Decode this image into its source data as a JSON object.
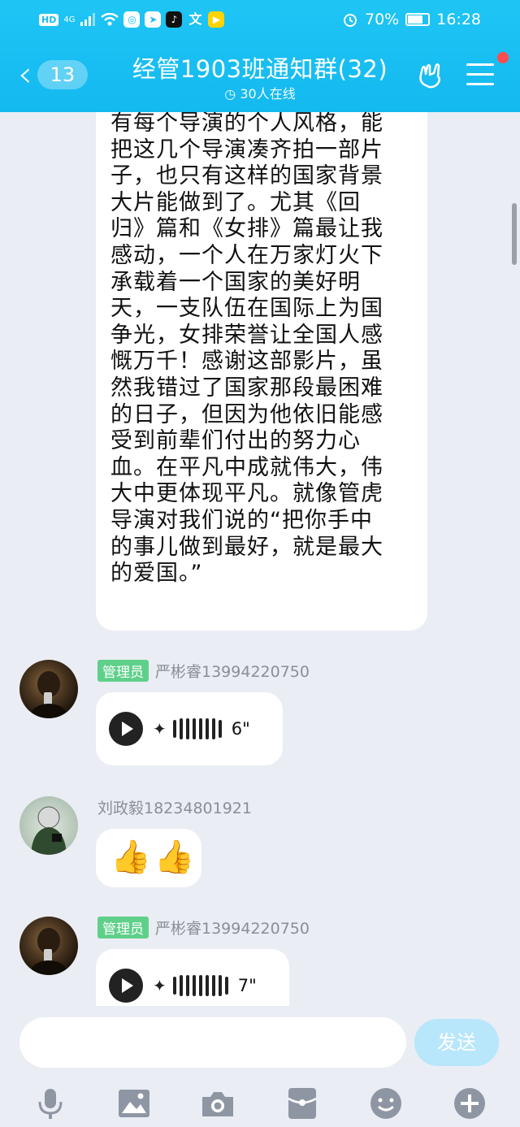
{
  "status_bar": {
    "net_badge": "HD",
    "signal": "4G",
    "battery": "70%",
    "time": "16:28"
  },
  "header": {
    "back_count": "13",
    "title": "经管1903班通知群(32)",
    "online": "30人在线"
  },
  "messages": {
    "long_text": "有每个导演的个人风格，能\n把这几个导演凑齐拍一部片\n子，也只有这样的国家背景\n大片能做到了。尤其《回\n归》篇和《女排》篇最让我\n感动，一个人在万家灯火下\n承载着一个国家的美好明\n天，一支队伍在国际上为国\n争光，女排荣誉让全国人感\n慨万千！感谢这部影片，虽\n然我错过了国家那段最困难\n的日子，但因为他依旧能感\n受到前辈们付出的努力心\n血。在平凡中成就伟大，伟\n大中更体现平凡。就像管虎\n导演对我们说的“把你手中\n的事儿做到最好，就是最大\n的爱国。”",
    "msg1": {
      "badge": "管理员",
      "sender": "严彬睿13994220750",
      "duration": "6\""
    },
    "msg2": {
      "sender": "刘政毅18234801921",
      "emoji": "👍👍"
    },
    "msg3": {
      "badge": "管理员",
      "sender": "严彬睿13994220750",
      "duration": "7\""
    }
  },
  "input": {
    "placeholder": "",
    "send_label": "发送"
  },
  "colors": {
    "header": "#1bbdf2",
    "admin_badge": "#5fd08a",
    "send_disabled": "#b8e6fb"
  }
}
